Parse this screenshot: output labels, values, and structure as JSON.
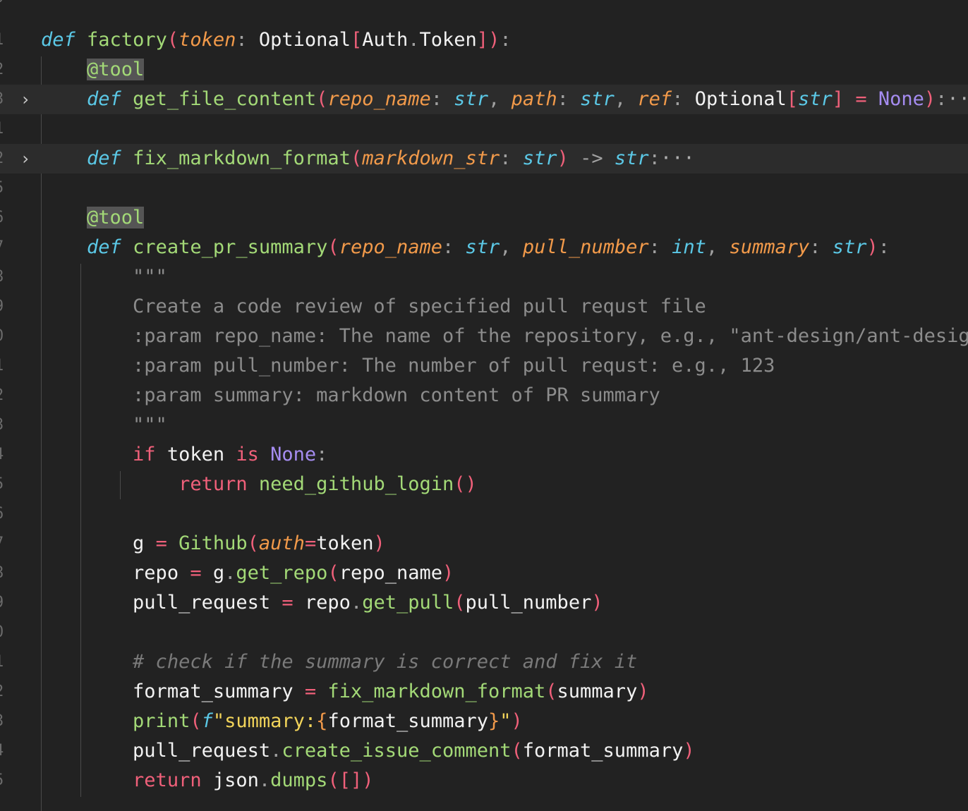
{
  "editor": {
    "line_numbers": [
      "0",
      "1",
      "2",
      "3",
      "1",
      "2",
      "5",
      "6",
      "7",
      "8",
      "9",
      "0",
      "1",
      "2",
      "3",
      "4",
      "5",
      "6",
      "7",
      "8",
      "9",
      "0",
      "1",
      "2",
      "3",
      "4",
      "5"
    ],
    "fold_glyph": "›",
    "ellipsis": "···"
  },
  "code": {
    "l1": {
      "def": "def",
      "fn": "factory",
      "p1": "(",
      "param": "token",
      "c1": ": ",
      "t1": "Optional",
      "b1": "[",
      "t2": "Auth",
      "dot": ".",
      "t3": "Token",
      "b2": "]",
      "p2": ")",
      "colon": ":"
    },
    "l2": {
      "decorator": "@tool"
    },
    "l3": {
      "def": "def",
      "fn": "get_file_content",
      "p1": "(",
      "a1": "repo_name",
      "c1": ": ",
      "t1": "str",
      "s1": ", ",
      "a2": "path",
      "c2": ": ",
      "t2": "str",
      "s2": ", ",
      "a3": "ref",
      "c3": ": ",
      "t3": "Optional",
      "b1": "[",
      "t4": "str",
      "b2": "]",
      "eq": " = ",
      "none": "None",
      "p2": ")",
      "colon": ":"
    },
    "l5": {
      "def": "def",
      "fn": "fix_markdown_format",
      "p1": "(",
      "a1": "markdown_str",
      "c1": ": ",
      "t1": "str",
      "p2": ")",
      "arrow": " -> ",
      "t2": "str",
      "colon": ":"
    },
    "l7": {
      "decorator": "@tool"
    },
    "l8": {
      "def": "def",
      "fn": "create_pr_summary",
      "p1": "(",
      "a1": "repo_name",
      "c1": ": ",
      "t1": "str",
      "s1": ", ",
      "a2": "pull_number",
      "c2": ": ",
      "t2": "int",
      "s2": ", ",
      "a3": "summary",
      "c3": ": ",
      "t3": "str",
      "p2": ")",
      "colon": ":"
    },
    "doc": [
      "\"\"\"",
      "Create a code review of specified pull requst file",
      ":param repo_name: The name of the repository, e.g., \"ant-design/ant-design\"",
      ":param pull_number: The number of pull requst: e.g., 123",
      ":param summary: markdown content of PR summary",
      "\"\"\""
    ],
    "l15": {
      "if": "if",
      "v": " token ",
      "is": "is",
      "sp": " ",
      "none": "None",
      "colon": ":"
    },
    "l16": {
      "ret": "return",
      "sp": " ",
      "fn": "need_github_login",
      "parens": "()"
    },
    "l18": {
      "v": "g",
      "eq": " = ",
      "fn": "Github",
      "p1": "(",
      "kw": "auth",
      "eq2": "=",
      "val": "token",
      "p2": ")"
    },
    "l19": {
      "v": "repo",
      "eq": " = ",
      "obj": "g",
      "dot": ".",
      "fn": "get_repo",
      "p1": "(",
      "arg": "repo_name",
      "p2": ")"
    },
    "l20": {
      "v": "pull_request",
      "eq": " = ",
      "obj": "repo",
      "dot": ".",
      "fn": "get_pull",
      "p1": "(",
      "arg": "pull_number",
      "p2": ")"
    },
    "l22": {
      "comment": "# check if the summary is correct and fix it"
    },
    "l23": {
      "v": "format_summary",
      "eq": " = ",
      "fn": "fix_markdown_format",
      "p1": "(",
      "arg": "summary",
      "p2": ")"
    },
    "l24": {
      "fn": "print",
      "p1": "(",
      "f": "f",
      "s1": "\"summary:",
      "b1": "{",
      "var": "format_summary",
      "b2": "}",
      "s2": "\"",
      "p2": ")"
    },
    "l25": {
      "obj": "pull_request",
      "dot": ".",
      "fn": "create_issue_comment",
      "p1": "(",
      "arg": "format_summary",
      "p2": ")"
    },
    "l26": {
      "ret": "return",
      "sp": " ",
      "obj": "json",
      "dot": ".",
      "fn": "dumps",
      "p1": "(",
      "b": "[]",
      "p2": ")"
    }
  },
  "colors": {
    "background": "#222222",
    "keyword": "#5bc8e6",
    "function": "#a3d977",
    "parameter": "#f29a4a",
    "control": "#f0607a",
    "constant": "#a58cf0",
    "string": "#f2d45a",
    "comment": "#7a7a7a"
  }
}
